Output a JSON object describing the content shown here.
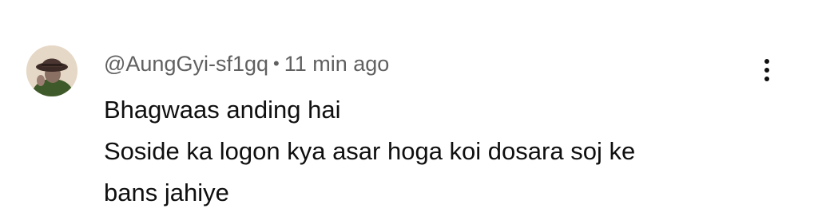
{
  "comment": {
    "author": "@AungGyi-sf1gq",
    "separator": "•",
    "time": "11 min ago",
    "lines": [
      "Bhagwaas anding hai",
      "Soside ka logon kya asar hoga koi dosara soj ke",
      "bans jahiye"
    ],
    "avatar_icon": "avatar-fedora-hat-person",
    "menu_icon": "more-vert-icon"
  },
  "colors": {
    "meta_text": "#606060",
    "body_text": "#0f0f0f",
    "background": "#ffffff"
  }
}
